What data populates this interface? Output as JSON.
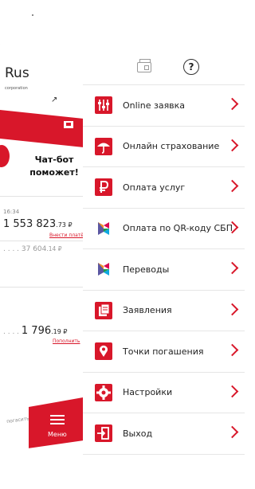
{
  "background_card": {
    "brand": "Rus",
    "brand_sub": "corporation",
    "chat_title": "Чат-бот поможет!",
    "time": "16:34",
    "amount1": "1 553 823",
    "amount1_cents": ".73 ₽",
    "link1": "Внести платёж",
    "amount2": "37 604",
    "amount2_cents": ".14 ₽",
    "amount3": "1 796",
    "amount3_cents": ".19 ₽",
    "link2": "Пополнить",
    "bottom_text": "погасить досрочно",
    "menu_label": "Меню"
  },
  "top": {
    "wallet_icon": "wallet-icon",
    "help_label": "?"
  },
  "menu": {
    "items": [
      {
        "label": "Online заявка",
        "icon": "online-request-icon"
      },
      {
        "label": "Онлайн страхование",
        "icon": "umbrella-icon"
      },
      {
        "label": "Оплата услуг",
        "icon": "ruble-icon"
      },
      {
        "label": "Оплата по QR-коду СБП",
        "icon": "sbp-icon"
      },
      {
        "label": "Переводы",
        "icon": "sbp-transfer-icon"
      },
      {
        "label": "Заявления",
        "icon": "documents-icon"
      },
      {
        "label": "Точки погашения",
        "icon": "map-pin-icon"
      },
      {
        "label": "Настройки",
        "icon": "gear-icon"
      },
      {
        "label": "Выход",
        "icon": "exit-icon"
      }
    ]
  },
  "colors": {
    "accent": "#d8172a",
    "divider": "#e6e6e6",
    "text": "#222222"
  }
}
